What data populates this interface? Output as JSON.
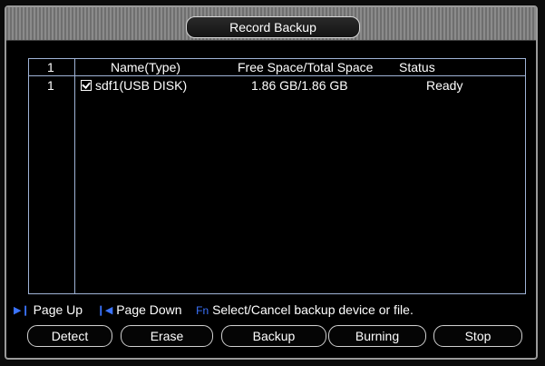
{
  "window": {
    "title": "Record Backup",
    "close_glyph": ""
  },
  "table": {
    "headers": {
      "index": "1",
      "name_type": "Name(Type)",
      "space": "Free Space/Total Space",
      "status": "Status"
    },
    "rows": [
      {
        "index": "1",
        "checked": true,
        "name_type": "sdf1(USB DISK)",
        "space": "1.86 GB/1.86 GB",
        "status": "Ready"
      }
    ]
  },
  "hints": {
    "page_up": "Page Up",
    "page_down": "Page Down",
    "fn_key": "Fn",
    "fn_desc": "Select/Cancel backup device or file.",
    "page_up_icon": "skip-next-icon",
    "page_down_icon": "skip-previous-icon"
  },
  "buttons": {
    "detect": "Detect",
    "erase": "Erase",
    "backup": "Backup",
    "burning": "Burning",
    "stop": "Stop"
  },
  "colors": {
    "accent": "#3b74ff",
    "table_border": "#9fb3d6",
    "background": "#000000",
    "text": "#ffffff"
  }
}
